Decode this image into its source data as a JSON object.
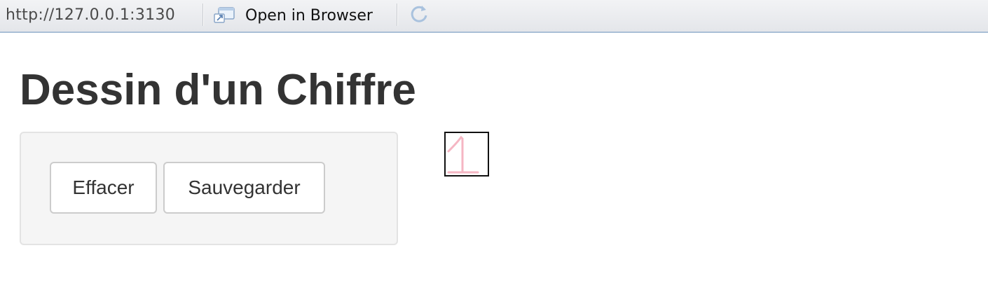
{
  "browser": {
    "url": "http://127.0.0.1:3130",
    "open_in_browser_label": "Open in Browser",
    "open_icon": "open-in-browser-icon",
    "refresh_icon": "refresh-icon"
  },
  "page": {
    "title": "Dessin d'un Chiffre"
  },
  "controls": {
    "clear_label": "Effacer",
    "save_label": "Sauvegarder"
  },
  "drawing_canvas": {
    "content": "digit 1 sketch",
    "stroke_color": "#f5b6c3"
  }
}
